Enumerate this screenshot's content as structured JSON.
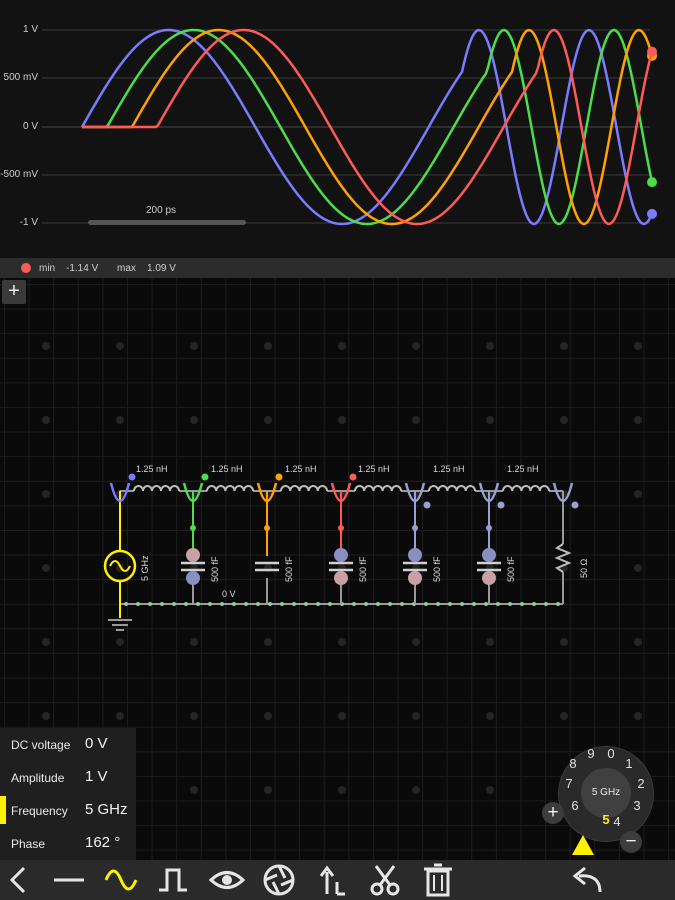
{
  "scope": {
    "y_axis_labels": [
      "1 V",
      "500 mV",
      "0 V",
      "-500 mV",
      "-1 V"
    ],
    "time_scale_label": "200 ps",
    "trace_colors": [
      "#7b7bff",
      "#4cdd4c",
      "#ffa200",
      "#ff5a5a"
    ],
    "status": {
      "indicator_color": "#ff5a5a",
      "min_label": "min",
      "min_value": "-1.14 V",
      "max_label": "max",
      "max_value": "1.09 V"
    },
    "add_button_label": "+"
  },
  "circuit": {
    "inductor_labels": [
      "1.25 nH",
      "1.25 nH",
      "1.25 nH",
      "1.25 nH",
      "1.25 nH",
      "1.25 nH"
    ],
    "capacitor_labels": [
      "500 fF",
      "500 fF",
      "500 fF",
      "500 fF",
      "500 fF"
    ],
    "source_label": "5 GHz",
    "resistor_label": "50 Ω",
    "ground_node_label": "0 V"
  },
  "properties": {
    "rows": [
      {
        "name": "DC voltage",
        "value": "0 V"
      },
      {
        "name": "Amplitude",
        "value": "1 V"
      },
      {
        "name": "Frequency",
        "value": "5 GHz"
      },
      {
        "name": "Phase",
        "value": "162 °"
      }
    ],
    "selected_row": "Frequency"
  },
  "dial": {
    "center_label": "5 GHz",
    "digits": [
      "0",
      "1",
      "2",
      "3",
      "4",
      "5",
      "6",
      "7",
      "8",
      "9"
    ],
    "selected_digit": "5",
    "plus_label": "+",
    "minus_label": "−"
  },
  "toolbar": {
    "icons": [
      "back-icon",
      "wire-icon",
      "sine-source-icon",
      "pulse-source-icon",
      "eye-icon",
      "aperture-icon",
      "arrow-up-icon",
      "cut-icon",
      "trash-icon",
      "undo-icon"
    ],
    "active_tool": "sine-source-icon",
    "accent_color": "#ffef00"
  }
}
